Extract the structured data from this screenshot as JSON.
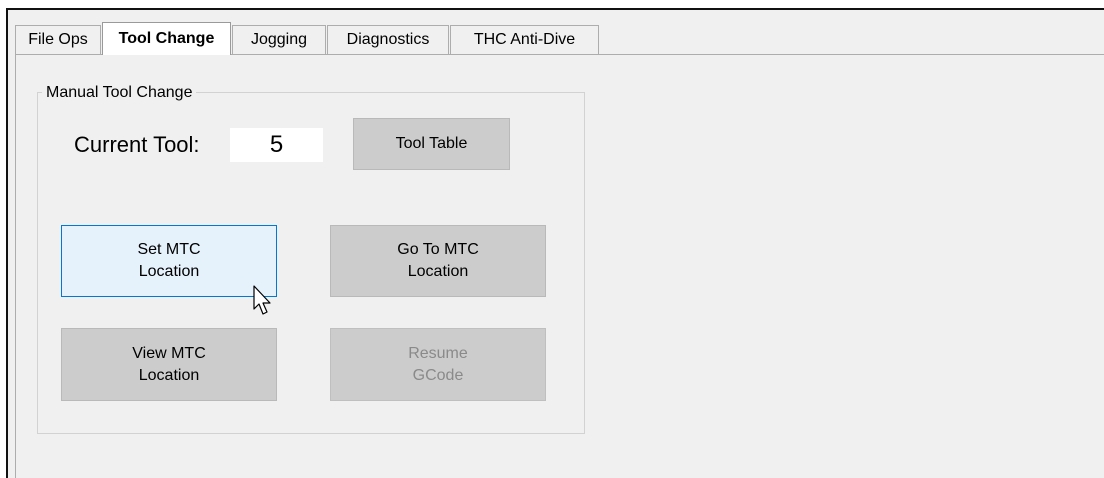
{
  "tabs": [
    {
      "label": "File Ops",
      "active": false
    },
    {
      "label": "Tool Change",
      "active": true
    },
    {
      "label": "Jogging",
      "active": false
    },
    {
      "label": "Diagnostics",
      "active": false
    },
    {
      "label": "THC Anti-Dive",
      "active": false
    }
  ],
  "group": {
    "title": "Manual Tool Change",
    "current_tool_label": "Current Tool:",
    "current_tool_value": "5"
  },
  "buttons": {
    "tool_table": "Tool Table",
    "set_mtc": "Set MTC\nLocation",
    "go_to_mtc": "Go To MTC\nLocation",
    "view_mtc": "View MTC\nLocation",
    "resume_gcode": "Resume\nGCode"
  },
  "colors": {
    "hover_button_bg": "#e5f1fb",
    "hover_button_border": "#0078d7",
    "button_bg": "#cccccc",
    "disabled_text": "#8a8a8a"
  },
  "icons": {
    "cursor": "mouse-pointer-icon"
  }
}
